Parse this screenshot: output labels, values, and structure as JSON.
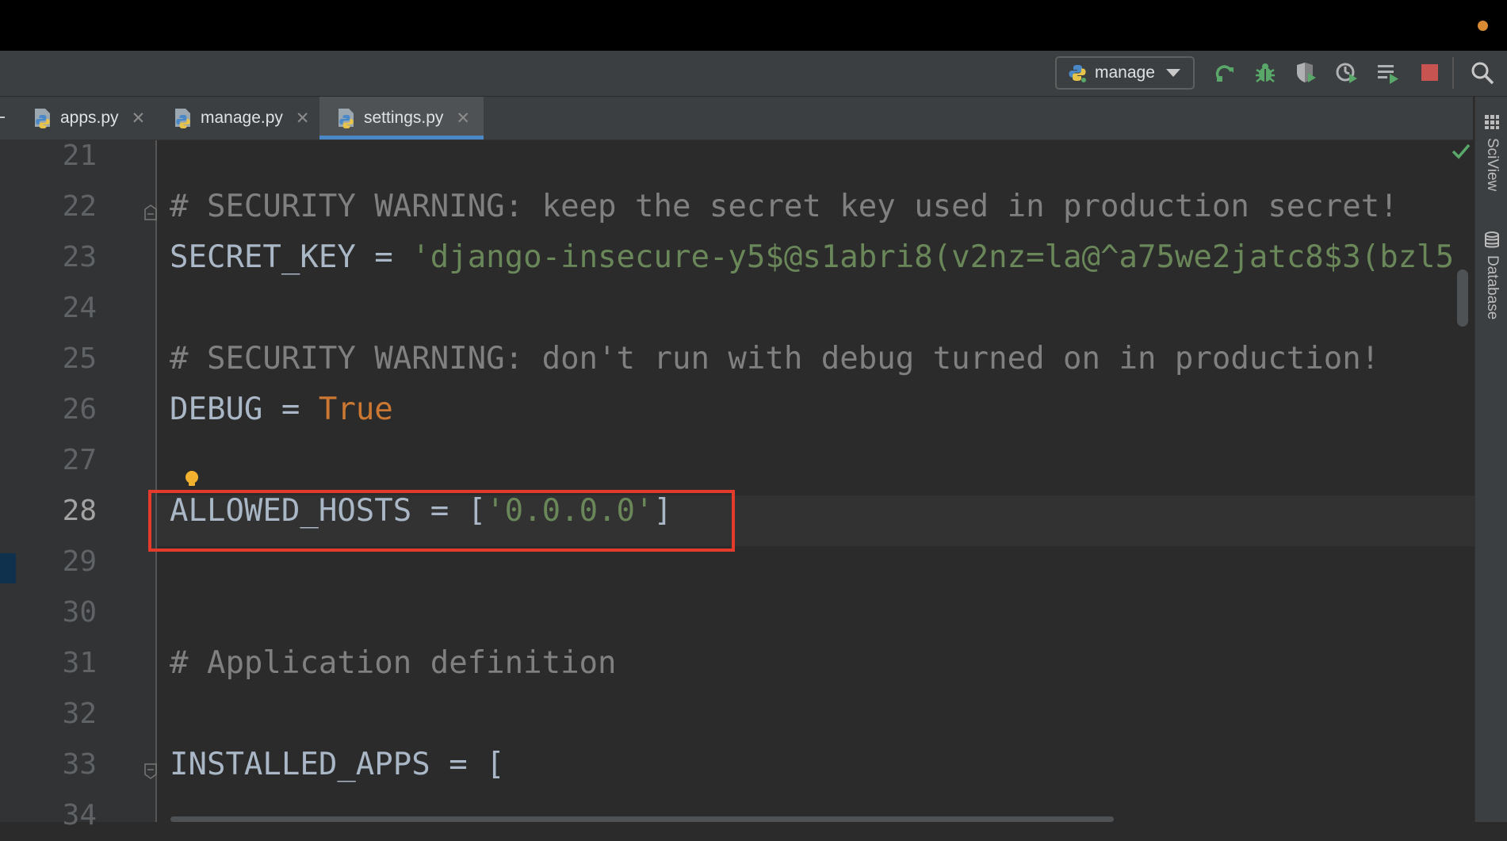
{
  "toolbar": {
    "run_config_label": "manage",
    "icons": [
      "rerun-icon",
      "debug-bug-icon",
      "coverage-shield-icon",
      "profile-icon",
      "run-list-icon",
      "stop-icon",
      "search-icon"
    ]
  },
  "tabs": [
    {
      "label": "apps.py",
      "close": "✕",
      "active": false
    },
    {
      "label": "manage.py",
      "close": "✕",
      "active": false
    },
    {
      "label": "settings.py",
      "close": "✕",
      "active": true
    }
  ],
  "right_panel": {
    "sciview": "SciView",
    "database": "Database"
  },
  "editor": {
    "current_line": 28,
    "lines": [
      {
        "n": "21",
        "text": ""
      },
      {
        "n": "22",
        "text": "# SECURITY WARNING: keep the secret key used in production secret!"
      },
      {
        "n": "23",
        "key": "SECRET_KEY",
        "op": " = ",
        "value": "'django-insecure-y5$@s1abri8(v2nz=la@^a75we2jatc8$3(bzl5"
      },
      {
        "n": "24",
        "text": ""
      },
      {
        "n": "25",
        "text": "# SECURITY WARNING: don't run with debug turned on in production!"
      },
      {
        "n": "26",
        "key": "DEBUG",
        "op": " = ",
        "value": "True"
      },
      {
        "n": "27",
        "text": ""
      },
      {
        "n": "28",
        "key": "ALLOWED_HOSTS",
        "op": " = [",
        "value": "'0.0.0.0'",
        "close": "]"
      },
      {
        "n": "29",
        "text": ""
      },
      {
        "n": "30",
        "text": ""
      },
      {
        "n": "31",
        "text": "# Application definition"
      },
      {
        "n": "32",
        "text": ""
      },
      {
        "n": "33",
        "text": "INSTALLED_APPS = ["
      },
      {
        "n": "34",
        "text": ""
      }
    ]
  },
  "colors": {
    "comment": "#808080",
    "string": "#6a8759",
    "keyword": "#cc7832",
    "highlight_box": "#e53b2c",
    "tab_underline": "#4a88c7"
  }
}
